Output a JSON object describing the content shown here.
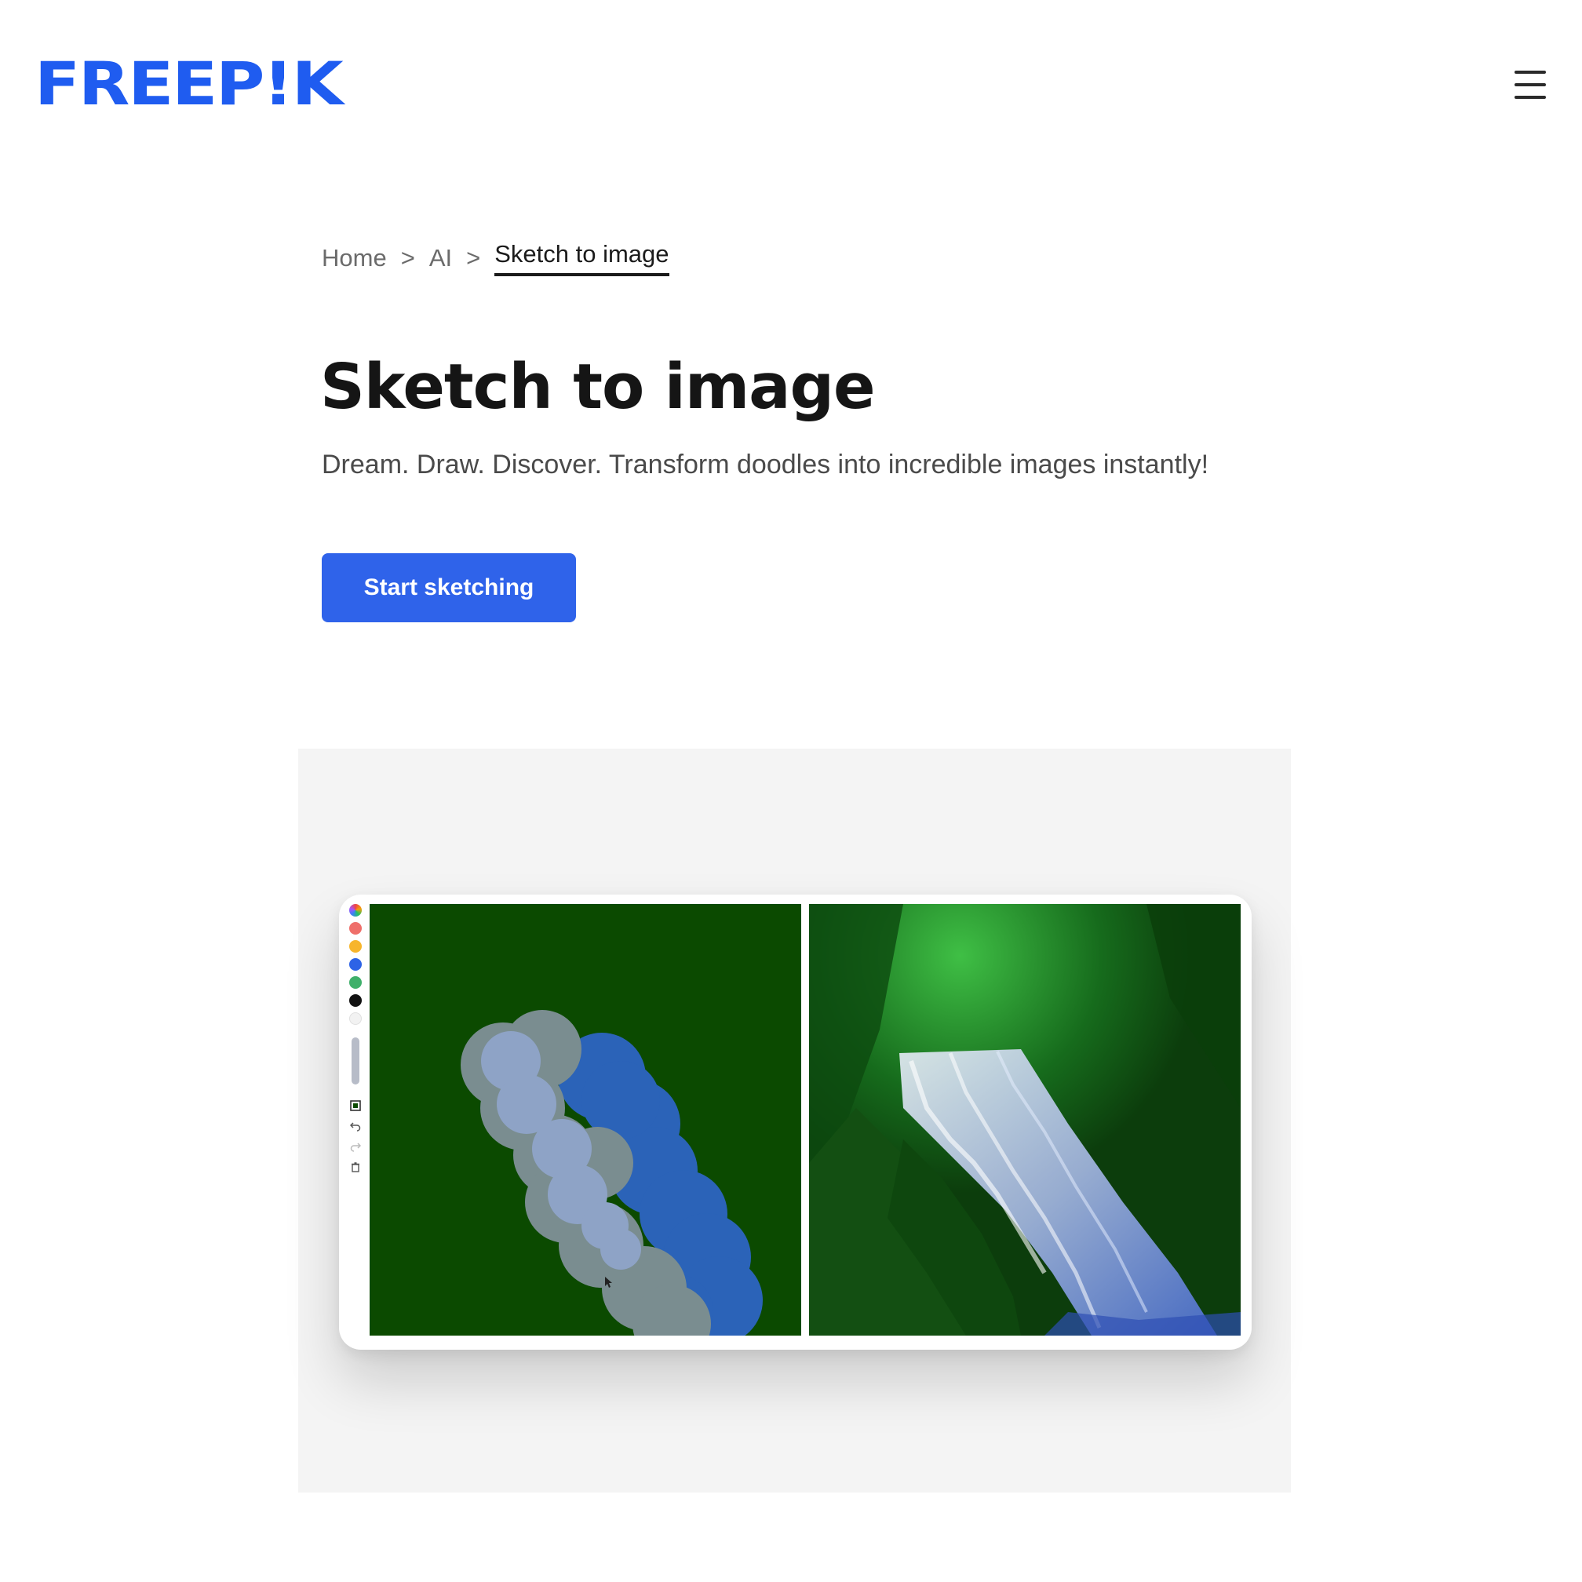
{
  "brand": {
    "logo_text": "FREEP!K",
    "accent": "#1f5cf0"
  },
  "header": {
    "menu_icon": "hamburger-icon"
  },
  "breadcrumb": {
    "items": [
      {
        "label": "Home"
      },
      {
        "label": "AI"
      },
      {
        "label": "Sketch to image"
      }
    ],
    "separator": ">"
  },
  "hero": {
    "title": "Sketch to image",
    "subtitle": "Dream. Draw. Discover. Transform doodles into incredible images instantly!",
    "cta_label": "Start sketching",
    "cta_color": "#2f63ea"
  },
  "preview": {
    "toolbar": {
      "swatches": [
        "#f2c14e",
        "#ef6f6a",
        "#f7b52c",
        "#2d63e6",
        "#3fb06a",
        "#111111",
        "#f2f2f2"
      ],
      "tools": [
        "color-picker-icon",
        "undo-icon",
        "redo-icon",
        "trash-icon"
      ]
    },
    "sketch_panel": {
      "background": "#0b4a00"
    },
    "result_panel": {
      "background": "#0f4a10"
    }
  }
}
